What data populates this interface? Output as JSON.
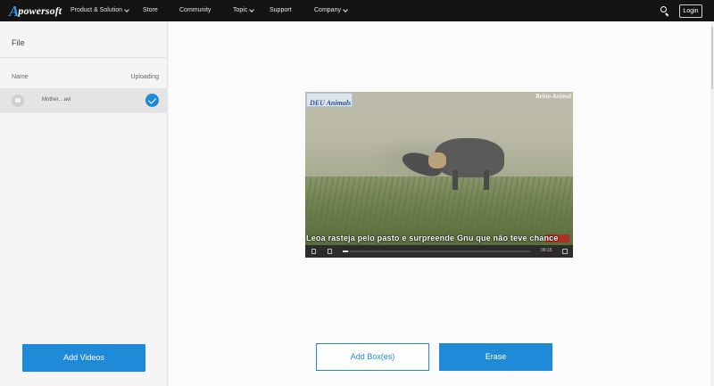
{
  "brand": {
    "logo_initial": "A",
    "logo_rest": "powersoft"
  },
  "nav": {
    "items": [
      {
        "label": "Product & Solution",
        "has_dropdown": true
      },
      {
        "label": "Store",
        "has_dropdown": false
      },
      {
        "label": "Community",
        "has_dropdown": false
      },
      {
        "label": "Topic",
        "has_dropdown": true
      },
      {
        "label": "Support",
        "has_dropdown": false
      },
      {
        "label": "Company",
        "has_dropdown": true
      }
    ],
    "search_icon": "search-icon",
    "login_label": "Login"
  },
  "sidebar": {
    "title": "File",
    "columns": {
      "name": "Name",
      "status": "Uploading"
    },
    "files": [
      {
        "name": "Mother…avi",
        "icon": "video-file-icon",
        "status_icon": "checkmark-icon"
      }
    ],
    "add_videos_label": "Add Videos"
  },
  "video": {
    "watermark_left": "DEU Animals",
    "watermark_right": "Reino Animal",
    "subtitle": "Leoa rasteja pelo pasto e surpreende Gnu que não teve chance",
    "time": "00:15",
    "progress_fraction": 0.03
  },
  "actions": {
    "add_box_label": "Add Box(es)",
    "erase_label": "Erase"
  },
  "colors": {
    "accent": "#1e8ad8",
    "topbar": "#141414",
    "logo_blue": "#2e9be0"
  }
}
